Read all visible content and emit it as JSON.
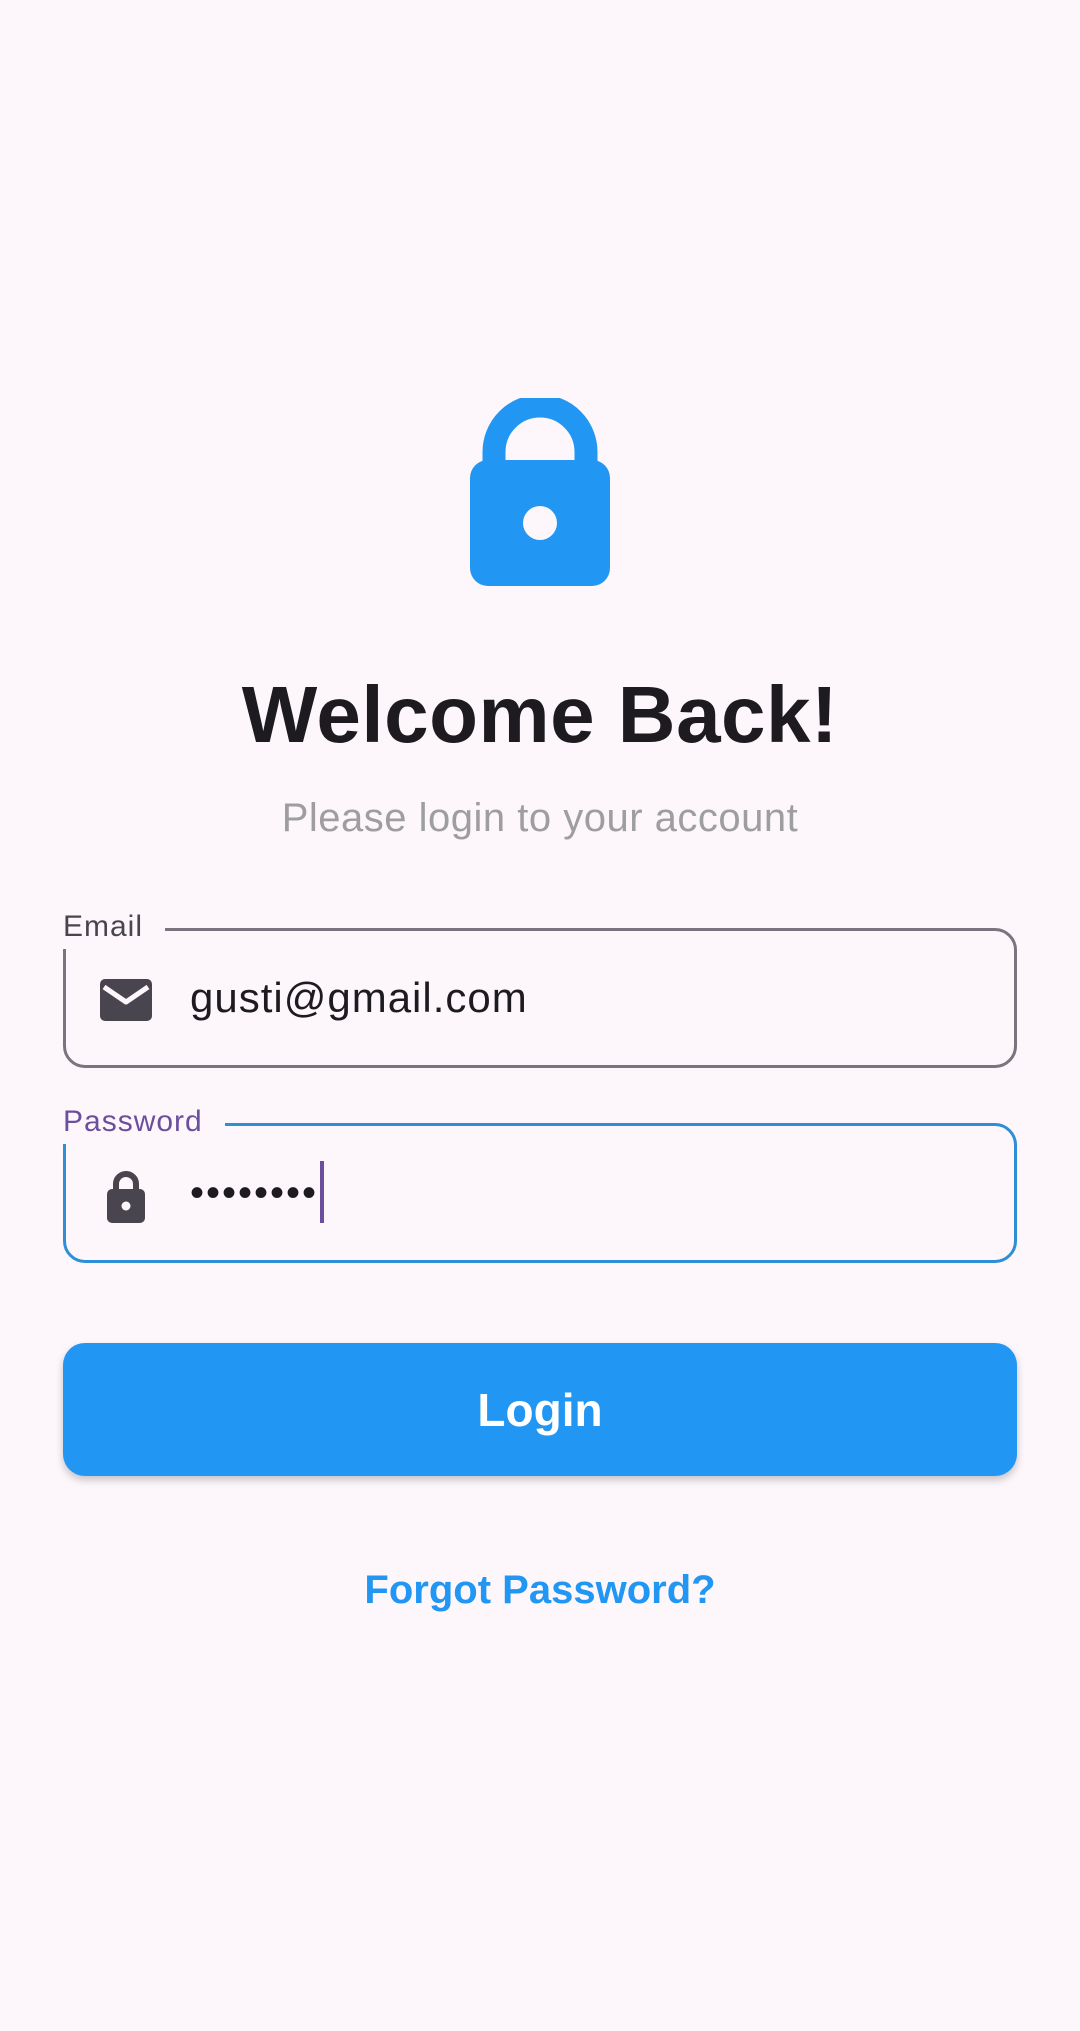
{
  "header": {
    "icon": "lock-icon",
    "title": "Welcome Back!",
    "subtitle": "Please login to your account"
  },
  "form": {
    "email": {
      "label": "Email",
      "icon": "email-icon",
      "value": "gusti@gmail.com"
    },
    "password": {
      "label": "Password",
      "icon": "lock-icon",
      "value": "••••••••",
      "focused": true
    },
    "login_label": "Login",
    "forgot_label": "Forgot Password?"
  },
  "colors": {
    "primary": "#2196F3",
    "background": "#FDF7FC",
    "focus_label": "#6B4F9E",
    "title": "#1D1B20",
    "subtitle": "#9E9E9E"
  }
}
